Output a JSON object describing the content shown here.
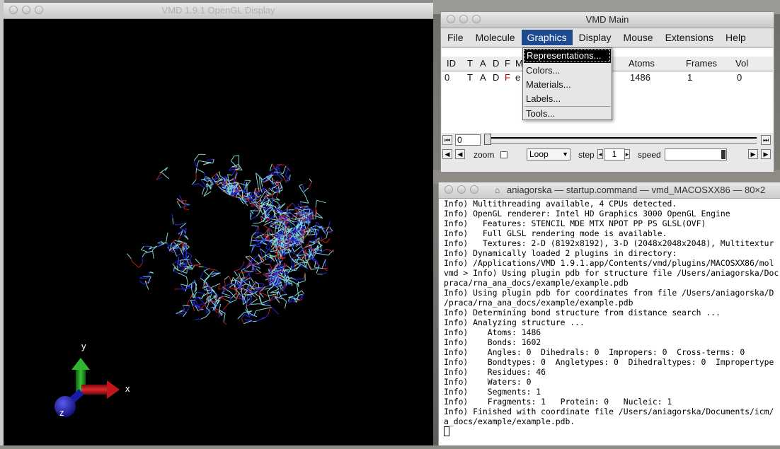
{
  "gl_window": {
    "title": "VMD 1.9.1 OpenGL Display"
  },
  "axes": {
    "x": "x",
    "y": "y",
    "z": "z"
  },
  "main_window": {
    "title": "VMD Main",
    "menu": [
      "File",
      "Molecule",
      "Graphics",
      "Display",
      "Mouse",
      "Extensions",
      "Help"
    ],
    "active_menu": "Graphics",
    "columns": [
      "ID",
      "T",
      "A",
      "D",
      "F",
      "M",
      "Atoms",
      "Frames",
      "Vol"
    ],
    "row": {
      "id": "0",
      "t": "T",
      "a": "A",
      "d": "D",
      "f": "F",
      "name": "e",
      "atoms": "1486",
      "frames": "1",
      "vol": "0"
    },
    "animation": {
      "frame": "0",
      "zoom_label": "zoom",
      "loop": "Loop",
      "step_label": "step",
      "step": "1",
      "speed_label": "speed"
    }
  },
  "graphics_menu": [
    "Representations...",
    "Colors...",
    "Materials...",
    "Labels...",
    "Tools..."
  ],
  "terminal": {
    "title": "aniagorska — startup.command — vmd_MACOSXX86 — 80×2",
    "lines": [
      "Info) Multithreading available, 4 CPUs detected.",
      "Info) OpenGL renderer: Intel HD Graphics 3000 OpenGL Engine",
      "Info)   Features: STENCIL MDE MTX NPOT PP PS GLSL(OVF)",
      "Info)   Full GLSL rendering mode is available.",
      "Info)   Textures: 2-D (8192x8192), 3-D (2048x2048x2048), Multitextur",
      "Info) Dynamically loaded 2 plugins in directory:",
      "Info) /Applications/VMD 1.9.1.app/Contents/vmd/plugins/MACOSXX86/mol",
      "vmd > Info) Using plugin pdb for structure file /Users/aniagorska/Doc",
      "praca/rna_ana_docs/example/example.pdb",
      "Info) Using plugin pdb for coordinates from file /Users/aniagorska/D",
      "/praca/rna_ana_docs/example/example.pdb",
      "Info) Determining bond structure from distance search ...",
      "Info) Analyzing structure ...",
      "Info)    Atoms: 1486",
      "Info)    Bonds: 1602",
      "Info)    Angles: 0  Dihedrals: 0  Impropers: 0  Cross-terms: 0",
      "Info)    Bondtypes: 0  Angletypes: 0  Dihedraltypes: 0  Impropertype",
      "Info)    Residues: 46",
      "Info)    Waters: 0",
      "Info)    Segments: 1",
      "Info)    Fragments: 1   Protein: 0   Nucleic: 1",
      "Info) Finished with coordinate file /Users/aniagorska/Documents/icm/",
      "a_docs/example/example.pdb."
    ]
  },
  "colors": {
    "menu_highlight": "#1e4b8f",
    "atom_cyan": "#7fd6d6",
    "atom_blue": "#2424e6",
    "atom_red": "#c41a10",
    "axis_x": "#c8161a",
    "axis_y": "#1a9a1a",
    "axis_z": "#1a1ab8"
  }
}
